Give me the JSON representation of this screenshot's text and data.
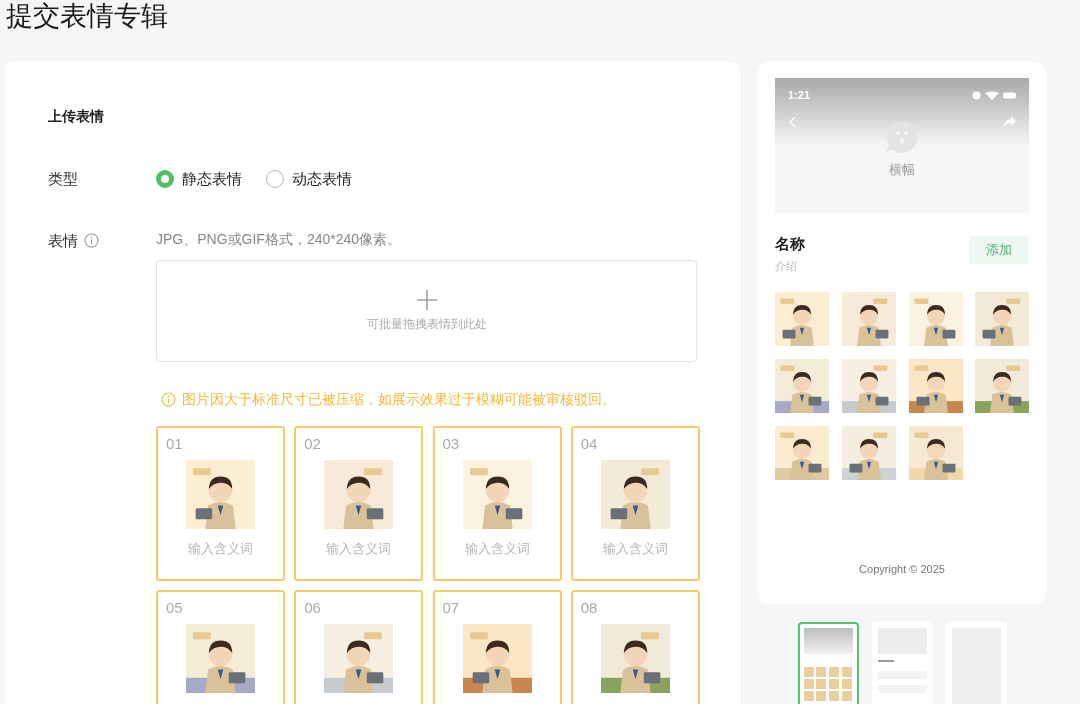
{
  "page_title": "提交表情专辑",
  "section_title": "上传表情",
  "type_field": {
    "label": "类型",
    "options": [
      {
        "label": "静态表情",
        "selected": true
      },
      {
        "label": "动态表情",
        "selected": false
      }
    ]
  },
  "sticker_field": {
    "label": "表情",
    "hint": "JPG、PNG或GIF格式，240*240像素。",
    "dropzone_text": "可批量拖拽表情到此处",
    "warning": "图片因大于标准尺寸已被压缩，如展示效果过于模糊可能被审核驳回。"
  },
  "stickers": [
    {
      "number": "01",
      "placeholder": "输入含义词"
    },
    {
      "number": "02",
      "placeholder": "输入含义词"
    },
    {
      "number": "03",
      "placeholder": "输入含义词"
    },
    {
      "number": "04",
      "placeholder": "输入含义词"
    },
    {
      "number": "05"
    },
    {
      "number": "06"
    },
    {
      "number": "07"
    },
    {
      "number": "08"
    }
  ],
  "preview": {
    "time": "1:21",
    "banner_label": "横幅",
    "name": "名称",
    "intro": "介绍",
    "add_button": {
      "label": "添加",
      "disabled": true
    },
    "copyright": "Copyright © 2025"
  },
  "templates": [
    {
      "selected": true
    },
    {
      "selected": false
    },
    {
      "selected": false
    }
  ]
}
